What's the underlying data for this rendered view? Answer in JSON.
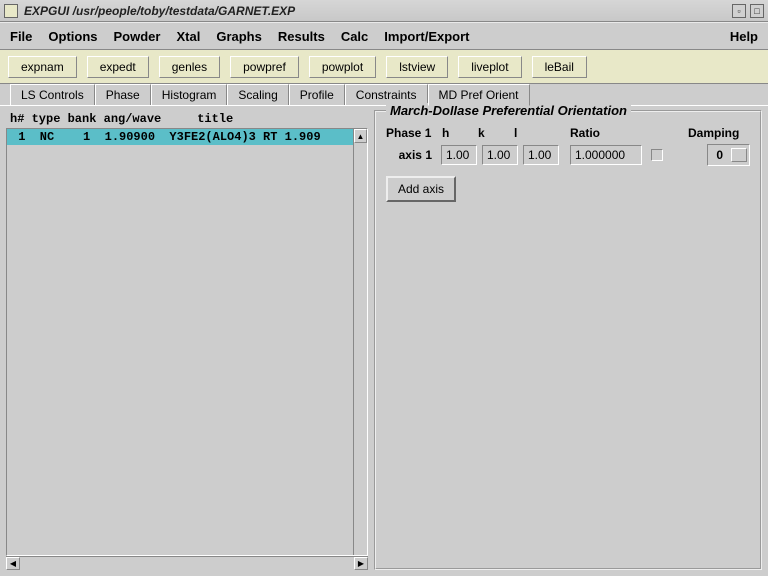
{
  "window": {
    "title": "EXPGUI /usr/people/toby/testdata/GARNET.EXP"
  },
  "menubar": {
    "items": [
      "File",
      "Options",
      "Powder",
      "Xtal",
      "Graphs",
      "Results",
      "Calc",
      "Import/Export"
    ],
    "help": "Help"
  },
  "toolbar": {
    "buttons": [
      "expnam",
      "expedt",
      "genles",
      "powpref",
      "powplot",
      "lstview",
      "liveplot",
      "leBail"
    ]
  },
  "tabs": {
    "items": [
      "LS Controls",
      "Phase",
      "Histogram",
      "Scaling",
      "Profile",
      "Constraints",
      "MD Pref Orient"
    ],
    "active_index": 6
  },
  "histogram_list": {
    "header": "h# type bank ang/wave     title",
    "rows": [
      {
        "text": " 1  NC    1  1.90900  Y3FE2(ALO4)3 RT 1.909",
        "selected": true
      }
    ]
  },
  "md_panel": {
    "title": "March-Dollase Preferential Orientation",
    "labels": {
      "phase": "Phase 1",
      "h": "h",
      "k": "k",
      "l": "l",
      "ratio": "Ratio",
      "damping": "Damping"
    },
    "axis": {
      "label": "axis 1",
      "h": "1.00",
      "k": "1.00",
      "l": "1.00",
      "ratio": "1.000000",
      "checked": false,
      "damping": "0"
    },
    "add_axis_label": "Add axis"
  }
}
